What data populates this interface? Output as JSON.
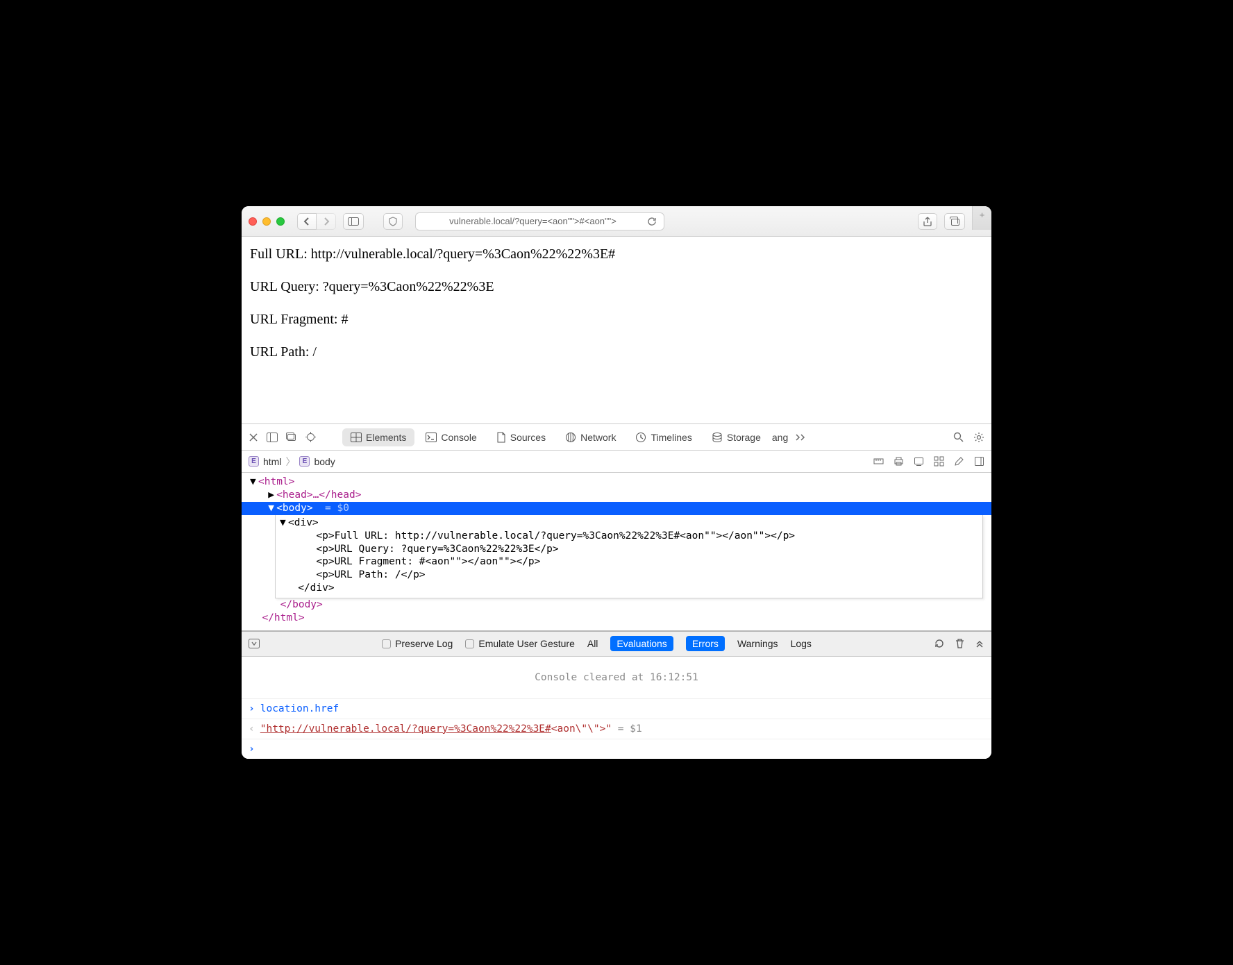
{
  "toolbar": {
    "url": "vulnerable.local/?query=<aon\"\">#<aon\"\">",
    "back_disabled": false,
    "forward_disabled": true
  },
  "page": {
    "full_url_label": "Full URL: http://vulnerable.local/?query=%3Caon%22%22%3E#",
    "url_query_label": "URL Query: ?query=%3Caon%22%22%3E",
    "url_fragment_label": "URL Fragment: #",
    "url_path_label": "URL Path: /"
  },
  "devtools": {
    "tabs": {
      "elements": "Elements",
      "console": "Console",
      "sources": "Sources",
      "network": "Network",
      "timelines": "Timelines",
      "storage": "Storage"
    },
    "breadcrumb": {
      "root": "html",
      "child": "body"
    },
    "dom": {
      "html_open": "<html>",
      "head": "<head>…</head>",
      "body_open": "<body>",
      "body_eq": "  = $0",
      "div_open": "<div>",
      "p1": "<p>Full URL: http://vulnerable.local/?query=%3Caon%22%22%3E#<aon\"\"></aon\"\"></p>",
      "p2": "<p>URL Query: ?query=%3Caon%22%22%3E</p>",
      "p3": "<p>URL Fragment: #<aon\"\"></aon\"\"></p>",
      "p4": "<p>URL Path: /</p>",
      "div_close": "</div>",
      "body_close": "</body>",
      "html_close": "</html>"
    }
  },
  "consolebar": {
    "preserve": "Preserve Log",
    "emulate": "Emulate User Gesture",
    "all": "All",
    "evaluations": "Evaluations",
    "errors": "Errors",
    "warnings": "Warnings",
    "logs": "Logs"
  },
  "console": {
    "cleared": "Console cleared at 16:12:51",
    "input1": "location.href",
    "output1_str": "\"http://vulnerable.local/?query=%3Caon%22%22%3E#",
    "output1_tag": "<aon\\\"\\\">",
    "output1_close": "\"",
    "output1_suffix": "  = $1"
  }
}
